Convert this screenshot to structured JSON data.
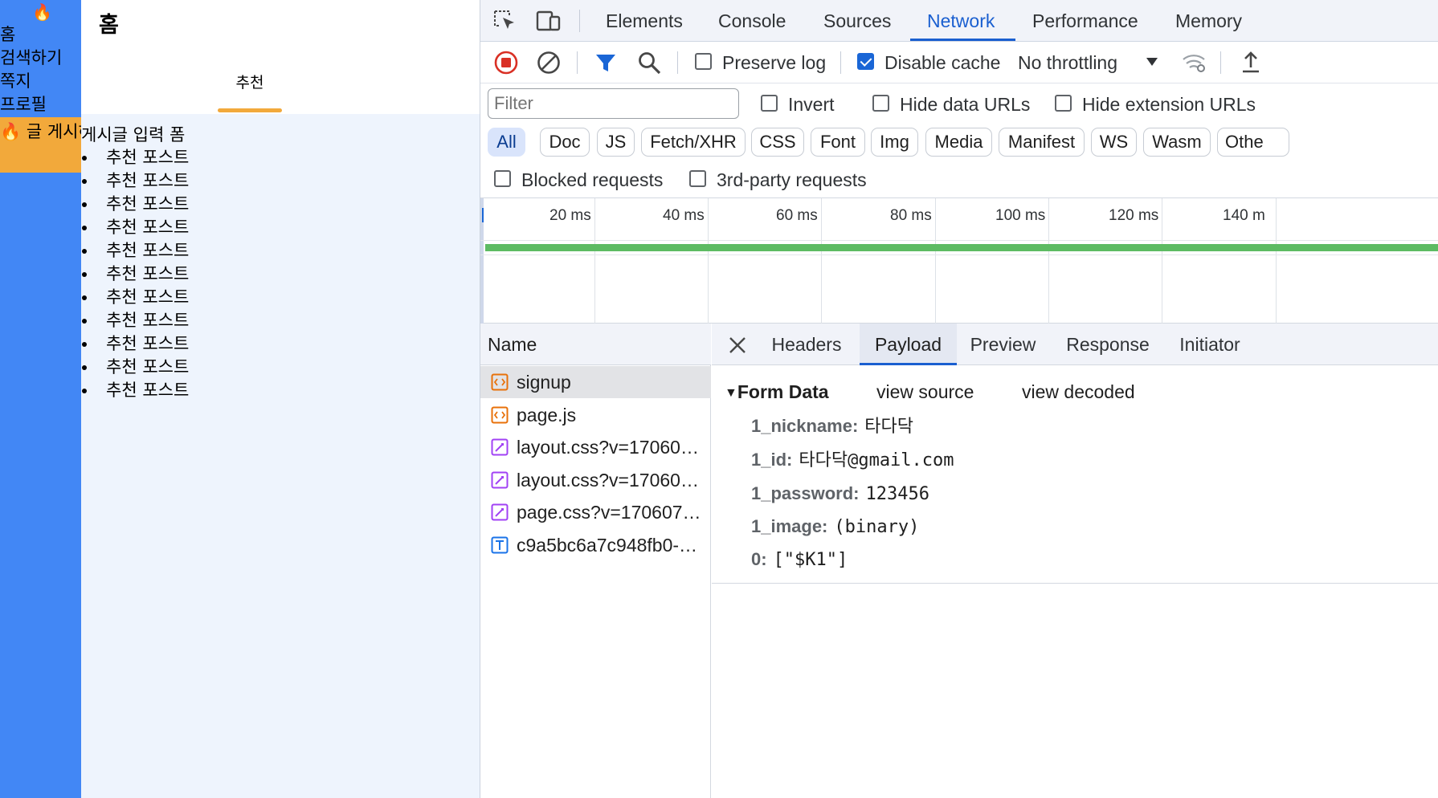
{
  "app": {
    "sidebar": {
      "fire_top": "🔥",
      "nav": [
        "홈",
        "검색하기",
        "쪽지",
        "프로필"
      ],
      "post_button": "🔥 글 게시하기 🔥"
    },
    "page_title": "홈",
    "tab_label": "추천",
    "form_label": "게시글 입력 폼",
    "posts": [
      "추천 포스트",
      "추천 포스트",
      "추천 포스트",
      "추천 포스트",
      "추천 포스트",
      "추천 포스트",
      "추천 포스트",
      "추천 포스트",
      "추천 포스트",
      "추천 포스트",
      "추천 포스트"
    ]
  },
  "devtools": {
    "tabs": [
      "Elements",
      "Console",
      "Sources",
      "Network",
      "Performance",
      "Memory"
    ],
    "active_tab": "Network",
    "toolbar": {
      "preserve_log": "Preserve log",
      "preserve_log_checked": false,
      "disable_cache": "Disable cache",
      "disable_cache_checked": true,
      "throttling": "No throttling"
    },
    "filter": {
      "placeholder": "Filter",
      "invert": "Invert",
      "hide_data_urls": "Hide data URLs",
      "hide_extension_urls": "Hide extension URLs"
    },
    "type_chips": [
      "All",
      "Doc",
      "JS",
      "Fetch/XHR",
      "CSS",
      "Font",
      "Img",
      "Media",
      "Manifest",
      "WS",
      "Wasm",
      "Othe"
    ],
    "active_chip": "All",
    "blocked_requests": "Blocked requests",
    "third_party_requests": "3rd-party requests",
    "timeline_labels": [
      "20 ms",
      "40 ms",
      "60 ms",
      "80 ms",
      "100 ms",
      "120 ms",
      "140 m"
    ],
    "name_header": "Name",
    "requests": [
      {
        "name": "signup",
        "icon": "document-icon",
        "color": "#e8710a"
      },
      {
        "name": "page.js",
        "icon": "script-icon",
        "color": "#e8710a"
      },
      {
        "name": "layout.css?v=17060…",
        "icon": "stylesheet-icon",
        "color": "#a142f4"
      },
      {
        "name": "layout.css?v=17060…",
        "icon": "stylesheet-icon",
        "color": "#a142f4"
      },
      {
        "name": "page.css?v=170607…",
        "icon": "stylesheet-icon",
        "color": "#a142f4"
      },
      {
        "name": "c9a5bc6a7c948fb0-…",
        "icon": "font-icon",
        "color": "#1a73e8"
      }
    ],
    "selected_request": "signup",
    "detail_tabs": [
      "Headers",
      "Payload",
      "Preview",
      "Response",
      "Initiator"
    ],
    "active_detail_tab": "Payload",
    "form_data": {
      "heading": "Form Data",
      "view_source": "view source",
      "view_decoded": "view decoded",
      "fields": [
        {
          "key": "1_nickname:",
          "value": "타다닥"
        },
        {
          "key": "1_id:",
          "value": "타다닥@gmail.com"
        },
        {
          "key": "1_password:",
          "value": "123456"
        },
        {
          "key": "1_image:",
          "value": "(binary)"
        },
        {
          "key": "0:",
          "value": "[\"$K1\"]"
        }
      ]
    }
  }
}
